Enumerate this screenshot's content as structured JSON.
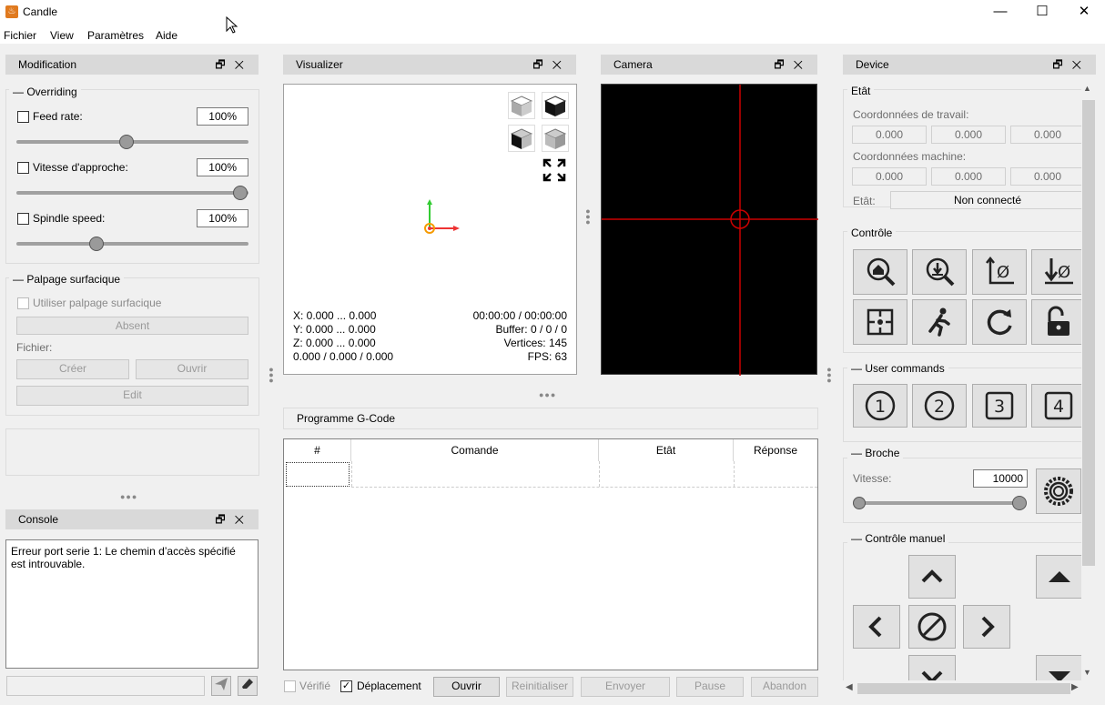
{
  "window": {
    "title": "Candle",
    "minimize": "—",
    "maximize": "☐",
    "close": "✕"
  },
  "menu": [
    "Fichier",
    "View",
    "Paramètres",
    "Aide"
  ],
  "modification": {
    "title": "Modification",
    "overriding": {
      "title": "Overriding",
      "items": [
        {
          "label": "Feed rate:",
          "value": "100%",
          "slider": 0.5
        },
        {
          "label": "Vitesse d'approche:",
          "value": "100%",
          "slider": 1.0
        },
        {
          "label": "Spindle speed:",
          "value": "100%",
          "slider": 0.35
        }
      ]
    },
    "palpage": {
      "title": "Palpage surfacique",
      "checkbox": "Utiliser palpage surfacique",
      "status": "Absent",
      "file_label": "Fichier:",
      "create": "Créer",
      "open": "Ouvrir",
      "edit": "Edit"
    }
  },
  "console": {
    "title": "Console",
    "text": "Erreur port serie 1: Le chemin d’accès spécifié est introuvable."
  },
  "visualizer": {
    "title": "Visualizer",
    "x": "X: 0.000 ... 0.000",
    "y": "Y: 0.000 ... 0.000",
    "z": "Z: 0.000 ... 0.000",
    "pos": "0.000 / 0.000 / 0.000",
    "time": "00:00:00 / 00:00:00",
    "buffer": "Buffer: 0 / 0 / 0",
    "vertices": "Vertices: 145",
    "fps": "FPS: 63"
  },
  "camera": {
    "title": "Camera"
  },
  "gcode": {
    "title": "Programme G-Code",
    "columns": [
      "#",
      "Comande",
      "Etât",
      "Réponse"
    ],
    "verified": "Vérifié",
    "deplacement": "Déplacement",
    "buttons": {
      "open": "Ouvrir",
      "reset": "Reinitialiser",
      "send": "Envoyer",
      "pause": "Pause",
      "abort": "Abandon"
    }
  },
  "device": {
    "title": "Device",
    "etat": {
      "title": "Etât",
      "work_label": "Coordonnées de travail:",
      "work": [
        "0.000",
        "0.000",
        "0.000"
      ],
      "machine_label": "Coordonnées machine:",
      "machine": [
        "0.000",
        "0.000",
        "0.000"
      ],
      "state_label": "Etât:",
      "state": "Non connecté"
    },
    "controle": {
      "title": "Contrôle"
    },
    "user_commands": {
      "title": "User commands",
      "items": [
        "1",
        "2",
        "3",
        "4"
      ]
    },
    "broche": {
      "title": "Broche",
      "speed_label": "Vitesse:",
      "speed": "10000"
    },
    "manual": {
      "title": "Contrôle manuel"
    }
  }
}
